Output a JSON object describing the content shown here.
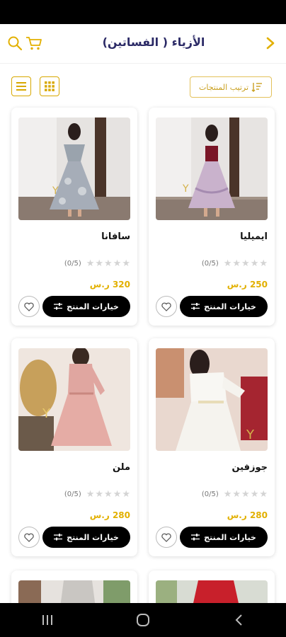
{
  "header": {
    "title": "الأزياء ( الفساتين)"
  },
  "toolbar": {
    "sort_label": "ترتيب المنتجات"
  },
  "products": [
    {
      "name": "ايميليا",
      "rating_text": "(0/5)",
      "price": "250 ر.س",
      "options_label": "خيارات المنتج",
      "rating_value": 0
    },
    {
      "name": "سافانا",
      "rating_text": "(0/5)",
      "price": "320 ر.س",
      "options_label": "خيارات المنتج",
      "rating_value": 0
    },
    {
      "name": "جوزفين",
      "rating_text": "(0/5)",
      "price": "280 ر.س",
      "options_label": "خيارات المنتج",
      "rating_value": 0
    },
    {
      "name": "ملن",
      "rating_text": "(0/5)",
      "price": "280 ر.س",
      "options_label": "خيارات المنتج",
      "rating_value": 0
    }
  ],
  "colors": {
    "accent_gold": "#e2b000",
    "title_navy": "#2b2a66",
    "button_black": "#000000"
  },
  "icons": {
    "search": "search-icon",
    "cart": "cart-icon",
    "back": "chevron-right-icon",
    "list_view": "list-view-icon",
    "grid_view": "grid-view-icon",
    "sort": "sort-icon",
    "favorite": "heart-icon",
    "options": "sliders-icon"
  }
}
